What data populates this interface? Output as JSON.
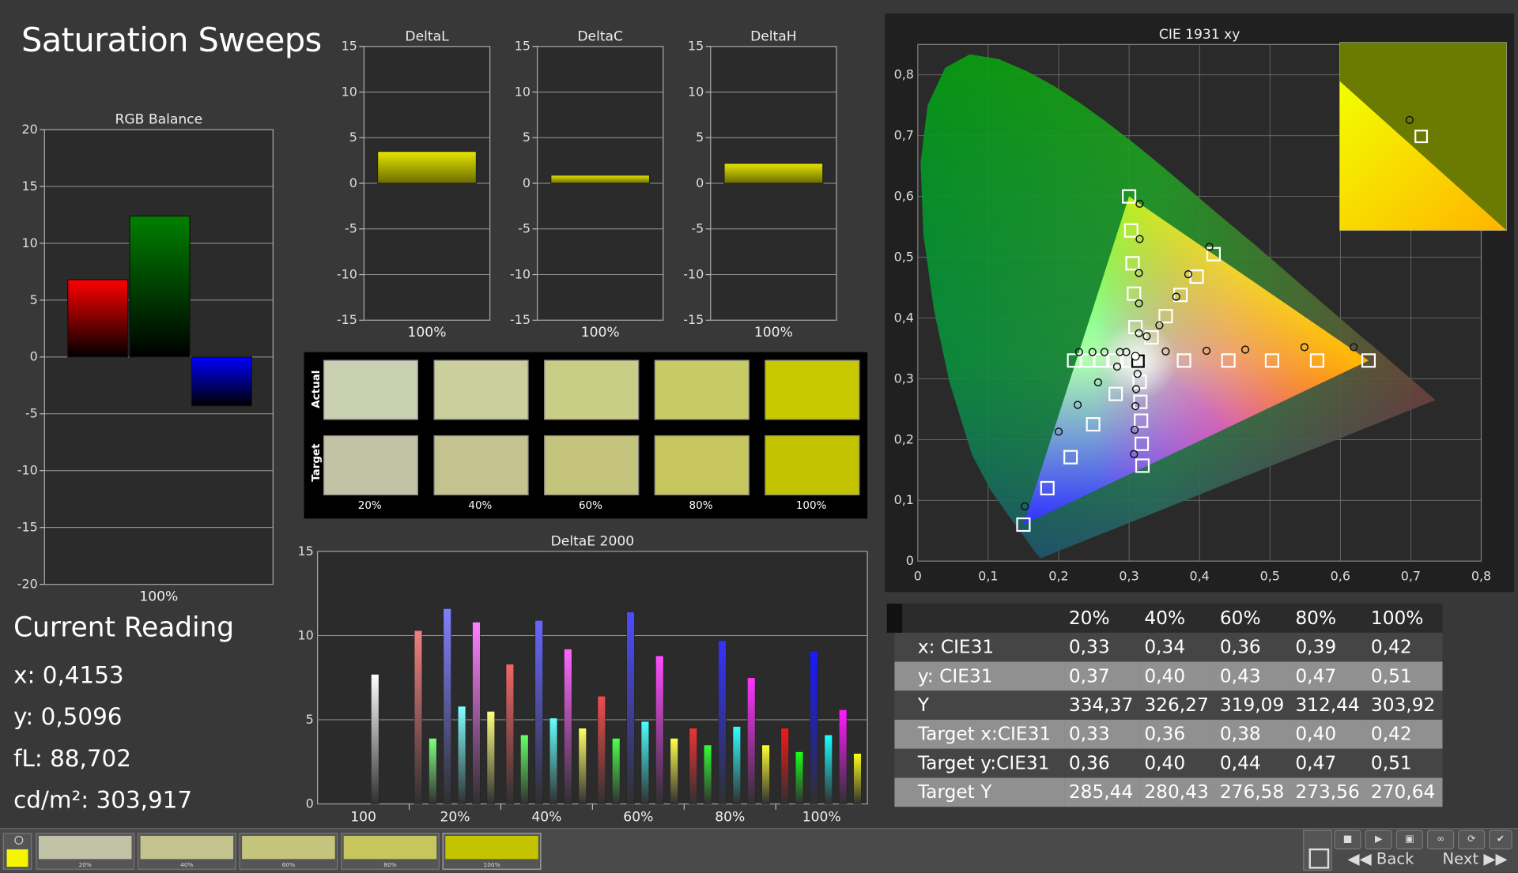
{
  "title": "Saturation Sweeps",
  "current_reading": {
    "heading": "Current Reading",
    "x": "x: 0,4153",
    "y": "y: 0,5096",
    "fl": "fL: 88,702",
    "cdm2": "cd/m²: 303,917"
  },
  "swatches": {
    "row_labels": [
      "Actual",
      "Target"
    ],
    "labels": [
      "20%",
      "40%",
      "60%",
      "80%",
      "100%"
    ],
    "actual_colors": [
      "#c9d1b2",
      "#cbcf9e",
      "#cacd86",
      "#c8cb64",
      "#c8c900"
    ],
    "target_colors": [
      "#c2c2a6",
      "#c4c390",
      "#c5c47c",
      "#c6c55e",
      "#c3c300"
    ]
  },
  "table": {
    "headers": [
      "",
      "20%",
      "40%",
      "60%",
      "80%",
      "100%"
    ],
    "rows": [
      [
        "x: CIE31",
        "0,33",
        "0,34",
        "0,36",
        "0,39",
        "0,42"
      ],
      [
        "y: CIE31",
        "0,37",
        "0,40",
        "0,43",
        "0,47",
        "0,51"
      ],
      [
        "Y",
        "334,37",
        "326,27",
        "319,09",
        "312,44",
        "303,92"
      ],
      [
        "Target x:CIE31",
        "0,33",
        "0,36",
        "0,38",
        "0,40",
        "0,42"
      ],
      [
        "Target y:CIE31",
        "0,36",
        "0,40",
        "0,44",
        "0,47",
        "0,51"
      ],
      [
        "Target Y",
        "285,44",
        "280,43",
        "276,58",
        "273,56",
        "270,64"
      ]
    ]
  },
  "bottom_bar": {
    "tiles": [
      {
        "label": "20%",
        "color": "#c2c2a6"
      },
      {
        "label": "40%",
        "color": "#c4c390"
      },
      {
        "label": "60%",
        "color": "#c5c47c"
      },
      {
        "label": "80%",
        "color": "#c6c55e"
      },
      {
        "label": "100%",
        "color": "#c3c300"
      }
    ],
    "back_label": "Back",
    "next_label": "Next"
  },
  "chart_data": [
    {
      "type": "bar",
      "title": "RGB Balance",
      "categories": [
        "100%"
      ],
      "series": [
        {
          "color": "#ff0000",
          "values": [
            6.8
          ]
        },
        {
          "color": "#008000",
          "values": [
            12.4
          ]
        },
        {
          "color": "#0000ff",
          "values": [
            -4.3
          ]
        }
      ],
      "ylim": [
        -20,
        20
      ],
      "yticks": [
        20,
        15,
        10,
        5,
        0,
        -5,
        -10,
        -15,
        -20
      ]
    },
    {
      "type": "bar",
      "title": "DeltaL",
      "categories": [
        "100%"
      ],
      "values": [
        3.5
      ],
      "ylim": [
        -15,
        15
      ],
      "yticks": [
        15,
        10,
        5,
        0,
        -5,
        -10,
        -15
      ]
    },
    {
      "type": "bar",
      "title": "DeltaC",
      "categories": [
        "100%"
      ],
      "values": [
        0.9
      ],
      "ylim": [
        -15,
        15
      ],
      "yticks": [
        15,
        10,
        5,
        0,
        -5,
        -10,
        -15
      ]
    },
    {
      "type": "bar",
      "title": "DeltaH",
      "categories": [
        "100%"
      ],
      "values": [
        2.2
      ],
      "ylim": [
        -15,
        15
      ],
      "yticks": [
        15,
        10,
        5,
        0,
        -5,
        -10,
        -15
      ]
    },
    {
      "type": "bar",
      "title": "DeltaE 2000",
      "categories": [
        "100",
        "20%",
        "40%",
        "60%",
        "80%",
        "100%"
      ],
      "ylim": [
        0,
        15
      ],
      "yticks": [
        15,
        10,
        5,
        0
      ],
      "groups": [
        {
          "values": [
            7.7
          ],
          "colors": [
            "#ffffff"
          ]
        },
        {
          "values": [
            10.3,
            3.9,
            11.6,
            5.8,
            10.8,
            5.5
          ],
          "colors": [
            "#f07f7f",
            "#80ff80",
            "#8080ff",
            "#80ffff",
            "#ff80ff",
            "#ffff80"
          ]
        },
        {
          "values": [
            8.3,
            4.1,
            10.9,
            5.1,
            9.2,
            4.5
          ],
          "colors": [
            "#f06666",
            "#66ff66",
            "#6666ff",
            "#66ffff",
            "#ff66ff",
            "#ffff66"
          ]
        },
        {
          "values": [
            6.4,
            3.9,
            11.4,
            4.9,
            8.8,
            3.9
          ],
          "colors": [
            "#f04c4c",
            "#4cff4c",
            "#4c4cff",
            "#4cffff",
            "#ff4cff",
            "#ffff4c"
          ]
        },
        {
          "values": [
            4.5,
            3.5,
            9.7,
            4.6,
            7.5,
            3.5
          ],
          "colors": [
            "#f03333",
            "#33ff33",
            "#3333ff",
            "#33ffff",
            "#ff33ff",
            "#ffff33"
          ]
        },
        {
          "values": [
            4.5,
            3.1,
            9.1,
            4.1,
            5.6,
            3.0
          ],
          "colors": [
            "#f01a1a",
            "#1aff1a",
            "#1a1aff",
            "#1affff",
            "#ff1aff",
            "#ffff1a"
          ]
        }
      ]
    },
    {
      "type": "scatter",
      "title": "CIE 1931 xy",
      "xlim": [
        0,
        0.8
      ],
      "ylim": [
        0,
        0.85
      ],
      "xticks": [
        0,
        0.1,
        0.2,
        0.3,
        0.4,
        0.5,
        0.6,
        0.7,
        0.8
      ],
      "yticks": [
        0,
        0.1,
        0.2,
        0.3,
        0.4,
        0.5,
        0.6,
        0.7,
        0.8
      ],
      "gamut_triangle": [
        [
          0.64,
          0.33
        ],
        [
          0.3,
          0.6
        ],
        [
          0.15,
          0.06
        ]
      ],
      "white_point": [
        0.3127,
        0.329
      ],
      "target_points": [
        [
          0.64,
          0.33
        ],
        [
          0.567,
          0.33
        ],
        [
          0.503,
          0.33
        ],
        [
          0.441,
          0.33
        ],
        [
          0.378,
          0.33
        ],
        [
          0.3,
          0.6
        ],
        [
          0.303,
          0.544
        ],
        [
          0.305,
          0.49
        ],
        [
          0.307,
          0.44
        ],
        [
          0.309,
          0.385
        ],
        [
          0.15,
          0.06
        ],
        [
          0.184,
          0.12
        ],
        [
          0.217,
          0.171
        ],
        [
          0.249,
          0.225
        ],
        [
          0.281,
          0.275
        ],
        [
          0.42,
          0.505
        ],
        [
          0.396,
          0.468
        ],
        [
          0.373,
          0.438
        ],
        [
          0.352,
          0.403
        ],
        [
          0.332,
          0.368
        ],
        [
          0.319,
          0.157
        ],
        [
          0.318,
          0.193
        ],
        [
          0.317,
          0.231
        ],
        [
          0.316,
          0.262
        ],
        [
          0.315,
          0.295
        ],
        [
          0.222,
          0.33
        ],
        [
          0.241,
          0.33
        ],
        [
          0.26,
          0.33
        ],
        [
          0.28,
          0.33
        ],
        [
          0.3,
          0.33
        ]
      ],
      "measured_points": [
        [
          0.619,
          0.352
        ],
        [
          0.549,
          0.352
        ],
        [
          0.465,
          0.348
        ],
        [
          0.41,
          0.346
        ],
        [
          0.352,
          0.345
        ],
        [
          0.315,
          0.588
        ],
        [
          0.315,
          0.53
        ],
        [
          0.314,
          0.474
        ],
        [
          0.314,
          0.424
        ],
        [
          0.314,
          0.375
        ],
        [
          0.152,
          0.09
        ],
        [
          0.2,
          0.213
        ],
        [
          0.227,
          0.257
        ],
        [
          0.256,
          0.294
        ],
        [
          0.283,
          0.32
        ],
        [
          0.414,
          0.517
        ],
        [
          0.384,
          0.472
        ],
        [
          0.367,
          0.435
        ],
        [
          0.343,
          0.388
        ],
        [
          0.325,
          0.37
        ],
        [
          0.307,
          0.176
        ],
        [
          0.308,
          0.216
        ],
        [
          0.309,
          0.255
        ],
        [
          0.31,
          0.283
        ],
        [
          0.312,
          0.308
        ],
        [
          0.229,
          0.344
        ],
        [
          0.248,
          0.344
        ],
        [
          0.265,
          0.344
        ],
        [
          0.287,
          0.344
        ],
        [
          0.296,
          0.344
        ]
      ],
      "inset_target": [
        0.42,
        0.505
      ],
      "inset_measured": [
        0.415,
        0.51
      ]
    }
  ]
}
